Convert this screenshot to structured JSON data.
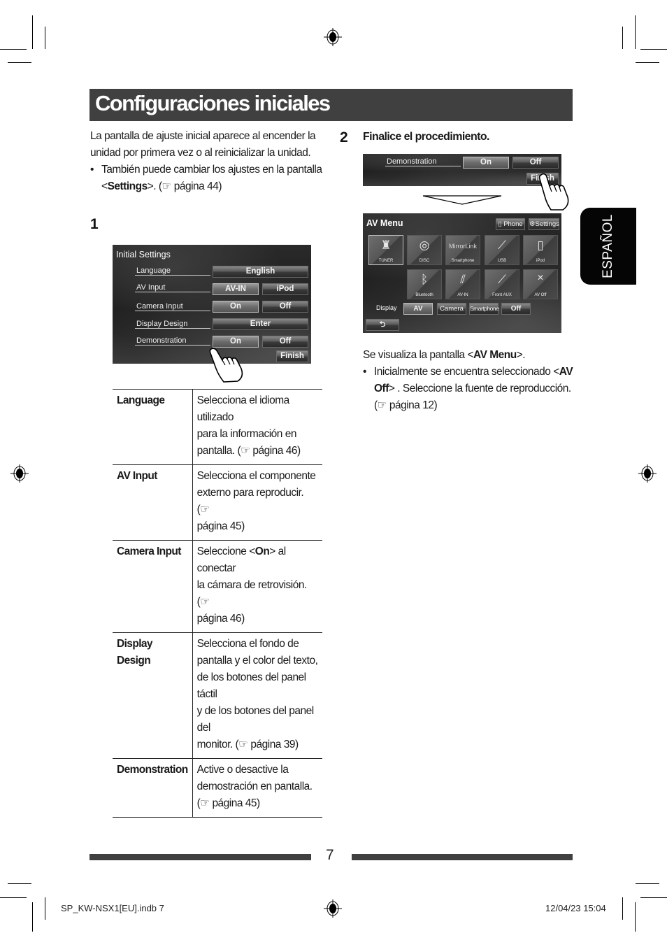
{
  "page": {
    "title": "Configuraciones iniciales",
    "language_tab": "ESPAÑOL",
    "page_number": "7"
  },
  "intro": {
    "line1": "La pantalla de ajuste inicial aparece al encender la",
    "line2": "unidad por primera vez o al reinicializar la unidad.",
    "bullet_line1": "También puede cambiar los ajustes en la pantalla",
    "bullet_line2_pre": "<",
    "bullet_line2_bold": "Settings",
    "bullet_line2_post": ">. (☞ página 44)"
  },
  "step1": {
    "number": "1",
    "screen": {
      "title": "Initial Settings",
      "rows": [
        {
          "label": "Language",
          "buttons": [
            {
              "label": "English",
              "selected": false
            }
          ]
        },
        {
          "label": "AV Input",
          "buttons": [
            {
              "label": "AV-IN",
              "selected": true
            },
            {
              "label": "iPod",
              "selected": false
            }
          ]
        },
        {
          "label": "Camera Input",
          "buttons": [
            {
              "label": "On",
              "selected": true
            },
            {
              "label": "Off",
              "selected": false
            }
          ]
        },
        {
          "label": "Display Design",
          "buttons": [
            {
              "label": "Enter",
              "selected": false
            }
          ]
        },
        {
          "label": "Demonstration",
          "buttons": [
            {
              "label": "On",
              "selected": true
            },
            {
              "label": "Off",
              "selected": false
            }
          ]
        }
      ],
      "finish_label": "Finish"
    },
    "table": [
      {
        "key": "Language",
        "lines": [
          "Selecciona el idioma utilizado",
          "para la información en",
          "pantalla. (☞ página 46)"
        ]
      },
      {
        "key": "AV Input",
        "lines": [
          "Selecciona el componente",
          "externo para reproducir. (☞",
          "página 45)"
        ]
      },
      {
        "key": "Camera Input",
        "lines_rich": {
          "pre": "Seleccione <",
          "bold": "On",
          "post": "> al conectar"
        },
        "lines": [
          "la cámara de retrovisión. (☞",
          "página 46)"
        ]
      },
      {
        "key_lines": [
          "Display",
          "Design"
        ],
        "lines": [
          "Selecciona el fondo de",
          "pantalla y el color del texto,",
          "de los botones del panel táctil",
          "y de los botones del panel del",
          "monitor. (☞ página 39)"
        ]
      },
      {
        "key": "Demonstration",
        "lines": [
          "Active o desactive la",
          "demostración en pantalla.",
          "(☞ página 45)"
        ]
      }
    ]
  },
  "step2": {
    "number": "2",
    "heading": "Finalice el procedimiento.",
    "demo_screen": {
      "label": "Demonstration",
      "on_label": "On",
      "off_label": "Off",
      "finish_label": "Finish"
    },
    "av_menu": {
      "title": "AV Menu",
      "phone_label": "Phone",
      "settings_label": "Settings",
      "sources_row1": [
        {
          "label": "TUNER",
          "icon": "tower-icon",
          "selected": true
        },
        {
          "label": "DISC",
          "icon": "disc-icon",
          "selected": false
        },
        {
          "label": "Smartphone",
          "icon": "mirrorlink-icon",
          "top_text": "MirrorLink",
          "selected": false
        },
        {
          "label": "USB",
          "icon": "usb-icon",
          "selected": false
        },
        {
          "label": "iPod",
          "icon": "ipod-icon",
          "selected": false
        }
      ],
      "sources_row2": [
        {
          "label": "Bluetooth",
          "icon": "bluetooth-icon"
        },
        {
          "label": "AV-IN",
          "icon": "rca-cable-icon"
        },
        {
          "label": "Front AUX",
          "icon": "aux-cable-icon"
        },
        {
          "label": "AV Off",
          "icon": "close-icon"
        }
      ],
      "display_label": "Display",
      "display_buttons": [
        {
          "label": "AV",
          "selected": true
        },
        {
          "label": "Camera",
          "selected": false
        },
        {
          "label": "Smartphone",
          "selected": false
        },
        {
          "label": "Off",
          "selected": false
        }
      ],
      "back_icon": "return-arrow-icon"
    },
    "caption_pre": "Se visualiza la pantalla <",
    "caption_bold": "AV Menu",
    "caption_post": ">.",
    "bullet_l1_pre": "Inicialmente se encuentra seleccionado <",
    "bullet_l1_bold": "AV",
    "bullet_l2_bold": "Off",
    "bullet_l2_post": "> . Seleccione la fuente de reproducción.",
    "bullet_l3": "(☞ página 12)"
  },
  "slug": {
    "file": "SP_KW-NSX1[EU].indb   7",
    "datetime": "12/04/23   15:04"
  }
}
